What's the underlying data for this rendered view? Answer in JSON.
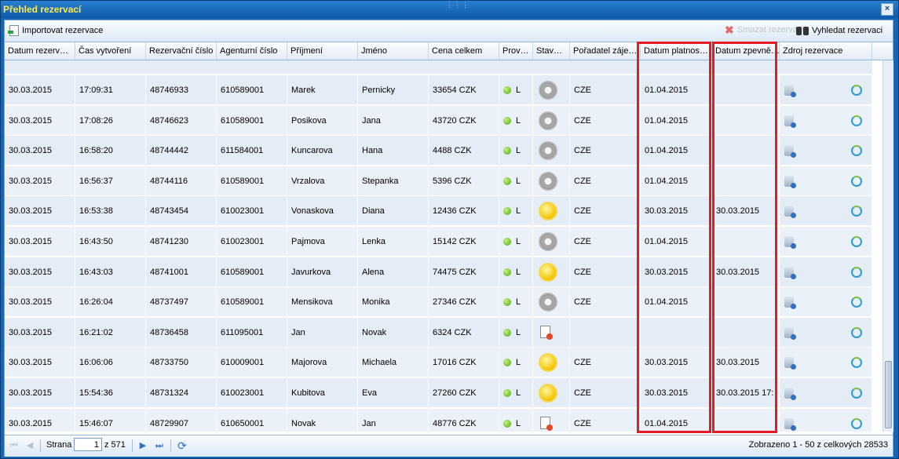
{
  "window": {
    "title": "Přehled rezervací",
    "close": "×",
    "grip": "⋮⋮⋮"
  },
  "toolbar": {
    "import_label": "Importovat rezervace",
    "delete_label": "Smazat rezervaci",
    "search_label": "Vyhledat rezervaci"
  },
  "columns": [
    "Datum rezerv…",
    "Čas vytvoření",
    "Rezervační číslo",
    "Agenturní číslo",
    "Příjmení",
    "Jméno",
    "Cena celkem",
    "Prov…",
    "Stav…",
    "Pořadatel záje…",
    "Datum platnos…",
    "Datum zpevně…",
    "Zdroj rezervace"
  ],
  "rows": [
    {
      "date": "30.03.2015",
      "time": "17:09:31",
      "res": "48746933",
      "agent": "610589001",
      "surname": "Marek",
      "name": "Pernicky",
      "price": "33654 CZK",
      "prov": "L",
      "status": "gear",
      "org": "CZE",
      "valid": "01.04.2015",
      "confirm": ""
    },
    {
      "date": "30.03.2015",
      "time": "17:08:26",
      "res": "48746623",
      "agent": "610589001",
      "surname": "Posikova",
      "name": "Jana",
      "price": "43720 CZK",
      "prov": "L",
      "status": "gear",
      "org": "CZE",
      "valid": "01.04.2015",
      "confirm": ""
    },
    {
      "date": "30.03.2015",
      "time": "16:58:20",
      "res": "48744442",
      "agent": "611584001",
      "surname": "Kuncarova",
      "name": "Hana",
      "price": "4488 CZK",
      "prov": "L",
      "status": "gear",
      "org": "CZE",
      "valid": "01.04.2015",
      "confirm": ""
    },
    {
      "date": "30.03.2015",
      "time": "16:56:37",
      "res": "48744116",
      "agent": "610589001",
      "surname": "Vrzalova",
      "name": "Stepanka",
      "price": "5396 CZK",
      "prov": "L",
      "status": "gear",
      "org": "CZE",
      "valid": "01.04.2015",
      "confirm": ""
    },
    {
      "date": "30.03.2015",
      "time": "16:53:38",
      "res": "48743454",
      "agent": "610023001",
      "surname": "Vonaskova",
      "name": "Diana",
      "price": "12436 CZK",
      "prov": "L",
      "status": "sun",
      "org": "CZE",
      "valid": "30.03.2015",
      "confirm": "30.03.2015"
    },
    {
      "date": "30.03.2015",
      "time": "16:43:50",
      "res": "48741230",
      "agent": "610023001",
      "surname": "Pajmova",
      "name": "Lenka",
      "price": "15142 CZK",
      "prov": "L",
      "status": "gear",
      "org": "CZE",
      "valid": "01.04.2015",
      "confirm": ""
    },
    {
      "date": "30.03.2015",
      "time": "16:43:03",
      "res": "48741001",
      "agent": "610589001",
      "surname": "Javurkova",
      "name": "Alena",
      "price": "74475 CZK",
      "prov": "L",
      "status": "sun",
      "org": "CZE",
      "valid": "30.03.2015",
      "confirm": "30.03.2015"
    },
    {
      "date": "30.03.2015",
      "time": "16:26:04",
      "res": "48737497",
      "agent": "610589001",
      "surname": "Mensikova",
      "name": "Monika",
      "price": "27346 CZK",
      "prov": "L",
      "status": "gear",
      "org": "CZE",
      "valid": "01.04.2015",
      "confirm": ""
    },
    {
      "date": "30.03.2015",
      "time": "16:21:02",
      "res": "48736458",
      "agent": "611095001",
      "surname": "Jan",
      "name": "Novak",
      "price": "6324 CZK",
      "prov": "L",
      "status": "doc",
      "org": "",
      "valid": "",
      "confirm": ""
    },
    {
      "date": "30.03.2015",
      "time": "16:06:06",
      "res": "48733750",
      "agent": "610009001",
      "surname": "Majorova",
      "name": "Michaela",
      "price": "17016 CZK",
      "prov": "L",
      "status": "sun",
      "org": "CZE",
      "valid": "30.03.2015",
      "confirm": "30.03.2015"
    },
    {
      "date": "30.03.2015",
      "time": "15:54:36",
      "res": "48731324",
      "agent": "610023001",
      "surname": "Kubitova",
      "name": "Eva",
      "price": "27260 CZK",
      "prov": "L",
      "status": "sun",
      "org": "CZE",
      "valid": "30.03.2015",
      "confirm": "30.03.2015 17:"
    },
    {
      "date": "30.03.2015",
      "time": "15:46:07",
      "res": "48729907",
      "agent": "610650001",
      "surname": "Novak",
      "name": "Jan",
      "price": "48776 CZK",
      "prov": "L",
      "status": "doc",
      "org": "CZE",
      "valid": "01.04.2015",
      "confirm": ""
    }
  ],
  "pager": {
    "page_label": "Strana",
    "page_value": "1",
    "of_label": "z 571",
    "summary": "Zobrazeno 1 - 50 z celkových 28533"
  },
  "colors": {
    "highlight": "#e31b23",
    "row_bg": "#e4ecf5",
    "title": "#ffe94a"
  }
}
